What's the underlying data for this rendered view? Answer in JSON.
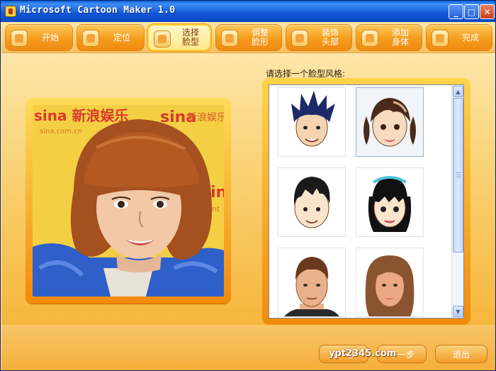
{
  "window": {
    "title": "Microsoft Cartoon Maker 1.0",
    "controls": {
      "minimize": "_",
      "maximize": "□",
      "close": "✕"
    }
  },
  "toolbar": {
    "steps": [
      {
        "label": "开始",
        "icon": "start-icon",
        "active": false
      },
      {
        "label": "定位",
        "icon": "locate-icon",
        "active": false
      },
      {
        "label": "选择\n脸型",
        "icon": "face-grid-icon",
        "active": true
      },
      {
        "label": "调整\n脸形",
        "icon": "adjust-face-icon",
        "active": false
      },
      {
        "label": "装饰\n头部",
        "icon": "decorate-head-icon",
        "active": false
      },
      {
        "label": "添加\n身体",
        "icon": "add-body-icon",
        "active": false
      },
      {
        "label": "完成",
        "icon": "finish-icon",
        "active": false
      }
    ]
  },
  "photo": {
    "backdrop_text": [
      "sina 新浪娱乐",
      "sina.com.cn",
      "sina",
      "新浪娱乐",
      "sin",
      "ent"
    ]
  },
  "face_list": {
    "prompt": "请选择一个脸型风格:",
    "faces": [
      {
        "name": "face-spiky-boy",
        "hair": "#1c2a6a",
        "skin": "#f6d3b0",
        "selected": false
      },
      {
        "name": "face-pigtail-girl",
        "hair": "#4a2a1a",
        "skin": "#f7dbc0",
        "selected": true
      },
      {
        "name": "face-short-hair-boy",
        "hair": "#1a1a1a",
        "skin": "#fae4cc",
        "selected": false
      },
      {
        "name": "face-bangs-girl",
        "hair": "#111111",
        "skin": "#fae4cc",
        "selected": false
      },
      {
        "name": "face-realistic-man",
        "hair": "#6a3a1e",
        "skin": "#e9b08c",
        "selected": false
      },
      {
        "name": "face-long-hair-woman",
        "hair": "#8a5430",
        "skin": "#eaa884",
        "selected": false
      }
    ]
  },
  "buttons": {
    "prev_label": "上一步",
    "next_label": "下一步",
    "exit_label": "退出"
  },
  "watermark": "ypt2345.com"
}
